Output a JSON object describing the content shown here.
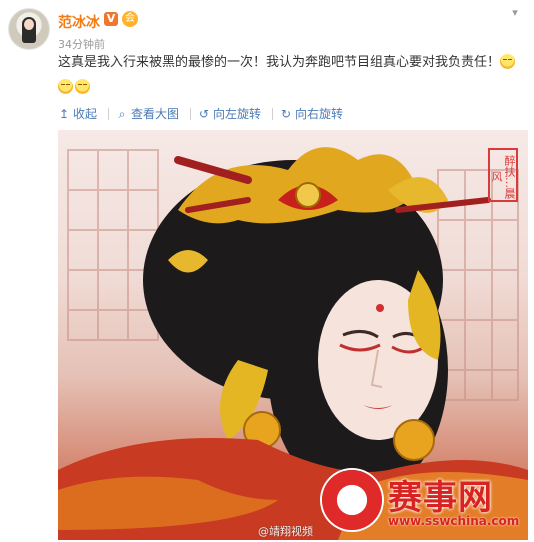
{
  "user": {
    "name": "范冰冰",
    "vip_badge": "V",
    "member_badge": "会",
    "time": "34分钟前"
  },
  "post": {
    "text": "这真是我入行来被黑的最惨的一次！我认为奔跑吧节目组真心要对我负责任！",
    "emoji_names": [
      "sleepy-face-emoji",
      "sleepy-face-emoji",
      "sleepy-face-emoji"
    ]
  },
  "toolbar": {
    "collapse": "收起",
    "view_large": "查看大图",
    "rotate_left": "向左旋转",
    "rotate_right": "向右旋转"
  },
  "photo": {
    "seal_text": "醉扶…晨风",
    "weibo_watermark": "@靖翔视频",
    "site_name": "赛事网",
    "site_url": "www.sswchina.com"
  },
  "colors": {
    "username": "#f47b13",
    "link": "#4b7bb5",
    "logo_red": "#d92323"
  }
}
